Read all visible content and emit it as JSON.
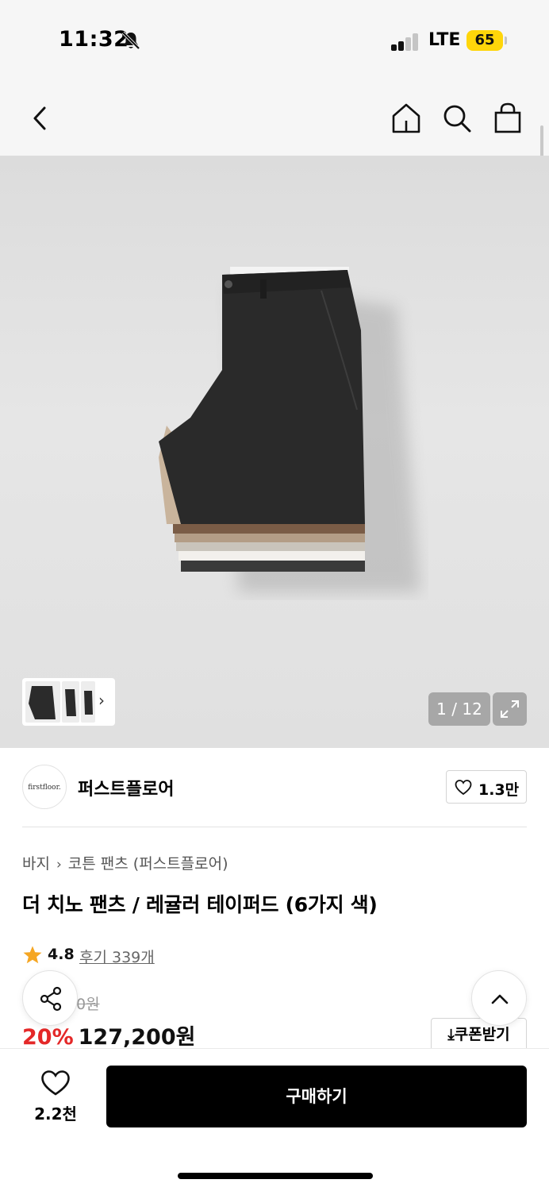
{
  "status_bar": {
    "time": "11:32",
    "network": "LTE",
    "battery": "65",
    "battery_color": "#ffd60a"
  },
  "nav": {
    "back_icon": "chevron-left-icon",
    "home_icon": "home-icon",
    "search_icon": "search-icon",
    "cart_icon": "shopping-bag-icon"
  },
  "gallery": {
    "page_counter": "1 / 12",
    "expand_icon": "expand-icon"
  },
  "brand": {
    "logo_text": "firstfloor.",
    "name": "퍼스트플로어",
    "like_count": "1.3만"
  },
  "product": {
    "breadcrumb": [
      "바지",
      "코튼 팬츠 (퍼스트플로어)"
    ],
    "title": "더 치노 팬츠 / 레귤러 테이퍼드 (6가지 색)",
    "rating": "4.8",
    "reviews": "후기 339개",
    "original_price": "0원",
    "discount": "20%",
    "price": "127,200원",
    "coupon_label": "쿠폰받기",
    "discount_color": "#e42828"
  },
  "bottom_bar": {
    "wish_count": "2.2천",
    "buy_label": "구매하기"
  }
}
